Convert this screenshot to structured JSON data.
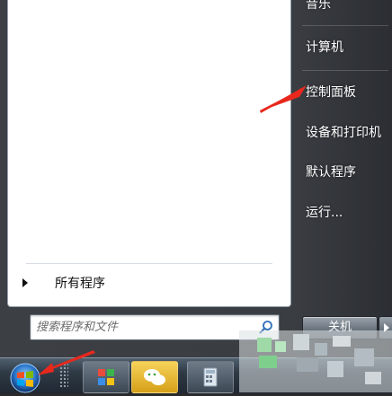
{
  "start_menu": {
    "all_programs_label": "所有程序",
    "search_placeholder": "搜索程序和文件",
    "right_items": [
      {
        "label": "音乐"
      },
      {
        "label": "计算机"
      },
      {
        "label": "控制面板"
      },
      {
        "label": "设备和打印机"
      },
      {
        "label": "默认程序"
      },
      {
        "label": "运行..."
      }
    ],
    "shutdown_label": "关机"
  },
  "taskbar": {
    "buttons": [
      {
        "icon": "pinwheel-app-icon",
        "color": "#e8d64a"
      },
      {
        "icon": "wechat-icon",
        "color": "#f0c94a"
      },
      {
        "icon": "calculator-icon",
        "color": "#d9e2ea"
      }
    ]
  },
  "colors": {
    "annotation_red": "#e8281c",
    "frame_dark": "#3a3d42"
  }
}
